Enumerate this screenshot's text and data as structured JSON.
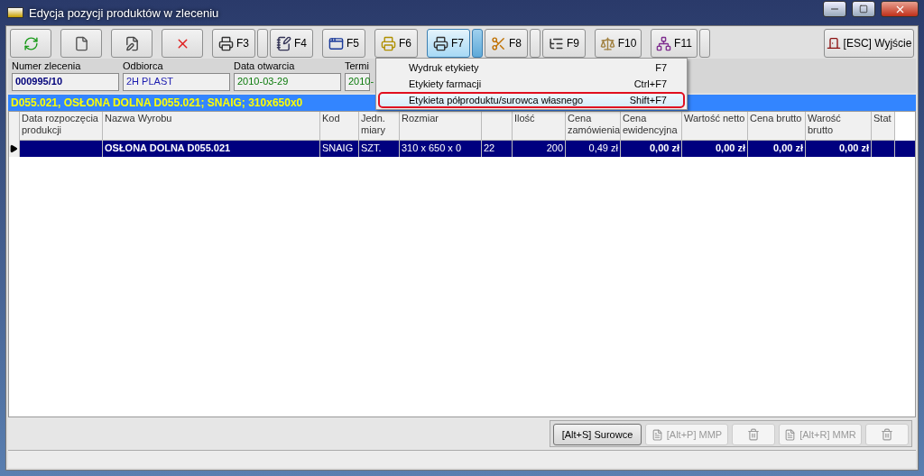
{
  "window": {
    "title": "Edycja pozycji produktów w zleceniu"
  },
  "toolbar": {
    "buttons": [
      {
        "kind": "refresh",
        "pressed": false,
        "split": false
      },
      {
        "kind": "new",
        "pressed": false,
        "split": false
      },
      {
        "kind": "edit",
        "pressed": false,
        "split": false
      },
      {
        "kind": "delete",
        "pressed": false,
        "split": false
      },
      {
        "kind": "print",
        "label": "F3",
        "pressed": false,
        "split": true
      },
      {
        "kind": "notes",
        "label": "F4",
        "pressed": false,
        "split": false
      },
      {
        "kind": "window",
        "label": "F5",
        "pressed": false,
        "split": false
      },
      {
        "kind": "print-yellow",
        "label": "F6",
        "pressed": false,
        "split": false
      },
      {
        "kind": "print",
        "label": "F7",
        "pressed": true,
        "split": true
      },
      {
        "kind": "scissors",
        "label": "F8",
        "pressed": false,
        "split": true
      },
      {
        "kind": "tree",
        "label": "F9",
        "pressed": false,
        "split": false
      },
      {
        "kind": "scale",
        "label": "F10",
        "pressed": false,
        "split": false
      },
      {
        "kind": "network",
        "label": "F11",
        "pressed": false,
        "split": true
      }
    ],
    "exit": {
      "label": "[ESC] Wyjście"
    }
  },
  "order_info": {
    "fields": [
      {
        "label": "Numer zlecenia",
        "value": "000995/10",
        "color": "#00007a"
      },
      {
        "label": "Odbiorca",
        "value": "2H PLAST",
        "color": "#1c1cb0"
      },
      {
        "label": "Data otwarcia",
        "value": "2010-03-29",
        "color": "#0a7a0a"
      },
      {
        "label": "Termi",
        "value": "2010-",
        "color": "#0a7a0a"
      }
    ]
  },
  "dropdown_menu": {
    "items": [
      {
        "label": "Wydruk etykiety",
        "shortcut": "F7",
        "selected": false
      },
      {
        "label": "Etykiety farmacji",
        "shortcut": "Ctrl+F7",
        "selected": false
      },
      {
        "label": "Etykieta półproduktu/surowca własnego",
        "shortcut": "Shift+F7",
        "selected": true
      }
    ]
  },
  "selection_bar": {
    "text": "D055.021, OSŁONA DOLNA D055.021; SNAIG; 310x650x0"
  },
  "table": {
    "columns": [
      "Data rozpoczęcia produkcji",
      "Nazwa Wyrobu",
      "Kod",
      "Jedn. miary",
      "Rozmiar",
      "",
      "Ilość",
      "Cena zamówienia",
      "Cena ewidencyjna",
      "Wartość netto",
      "Cena brutto",
      "Warość brutto",
      "Stat"
    ],
    "rows": [
      {
        "selected": true,
        "cells": [
          "",
          "OSŁONA DOLNA D055.021",
          "SNAIG",
          "SZT.",
          "310 x 650 x 0",
          "22",
          "200",
          "0,49 zł",
          "0,00 zł",
          "0,00 zł",
          "0,00 zł",
          "0,00 zł",
          ""
        ]
      }
    ]
  },
  "bottom_buttons": [
    {
      "label": "[Alt+S] Surowce",
      "kind": "text",
      "disabled": false
    },
    {
      "label": "[Alt+P] MMP",
      "kind": "document",
      "disabled": true
    },
    {
      "kind": "trash",
      "disabled": true
    },
    {
      "label": "[Alt+R] MMR",
      "kind": "document",
      "disabled": true
    },
    {
      "kind": "trash",
      "disabled": true
    }
  ]
}
